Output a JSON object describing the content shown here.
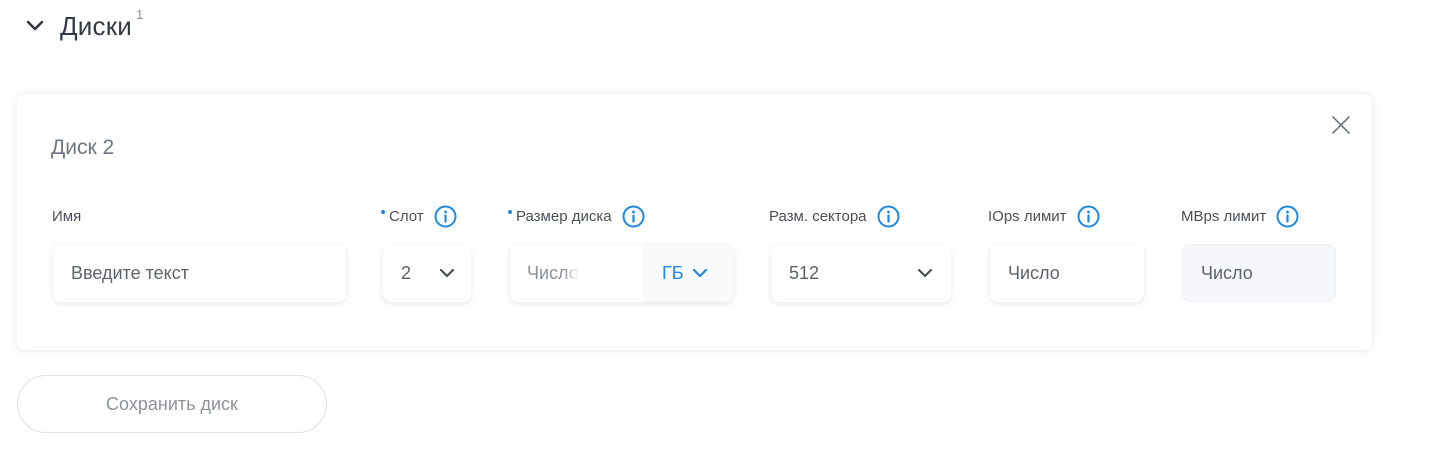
{
  "section": {
    "title": "Диски",
    "count": "1",
    "toggle_icon": "chevron-down-icon"
  },
  "disk_card": {
    "title": "Диск 2",
    "close_icon": "close-icon",
    "fields": {
      "name": {
        "label": "Имя",
        "placeholder": "Введите текст",
        "required": false
      },
      "slot": {
        "label": "Слот",
        "value": "2",
        "required": true,
        "icon": "info-icon"
      },
      "size": {
        "label": "Размер диска",
        "placeholder": "Число",
        "unit": "ГБ",
        "required": true,
        "icon": "info-icon"
      },
      "sector": {
        "label": "Разм. сектора",
        "value": "512",
        "required": false,
        "icon": "info-icon"
      },
      "iops": {
        "label": "IOps лимит",
        "placeholder": "Число",
        "required": false,
        "icon": "info-icon"
      },
      "mbps": {
        "label": "MBps лимит",
        "placeholder": "Число",
        "required": false,
        "icon": "info-icon",
        "disabled": true
      }
    }
  },
  "actions": {
    "save_label": "Сохранить диск"
  },
  "colors": {
    "accent": "#1e88e5",
    "text": "#333a44",
    "muted": "#8e949b"
  }
}
